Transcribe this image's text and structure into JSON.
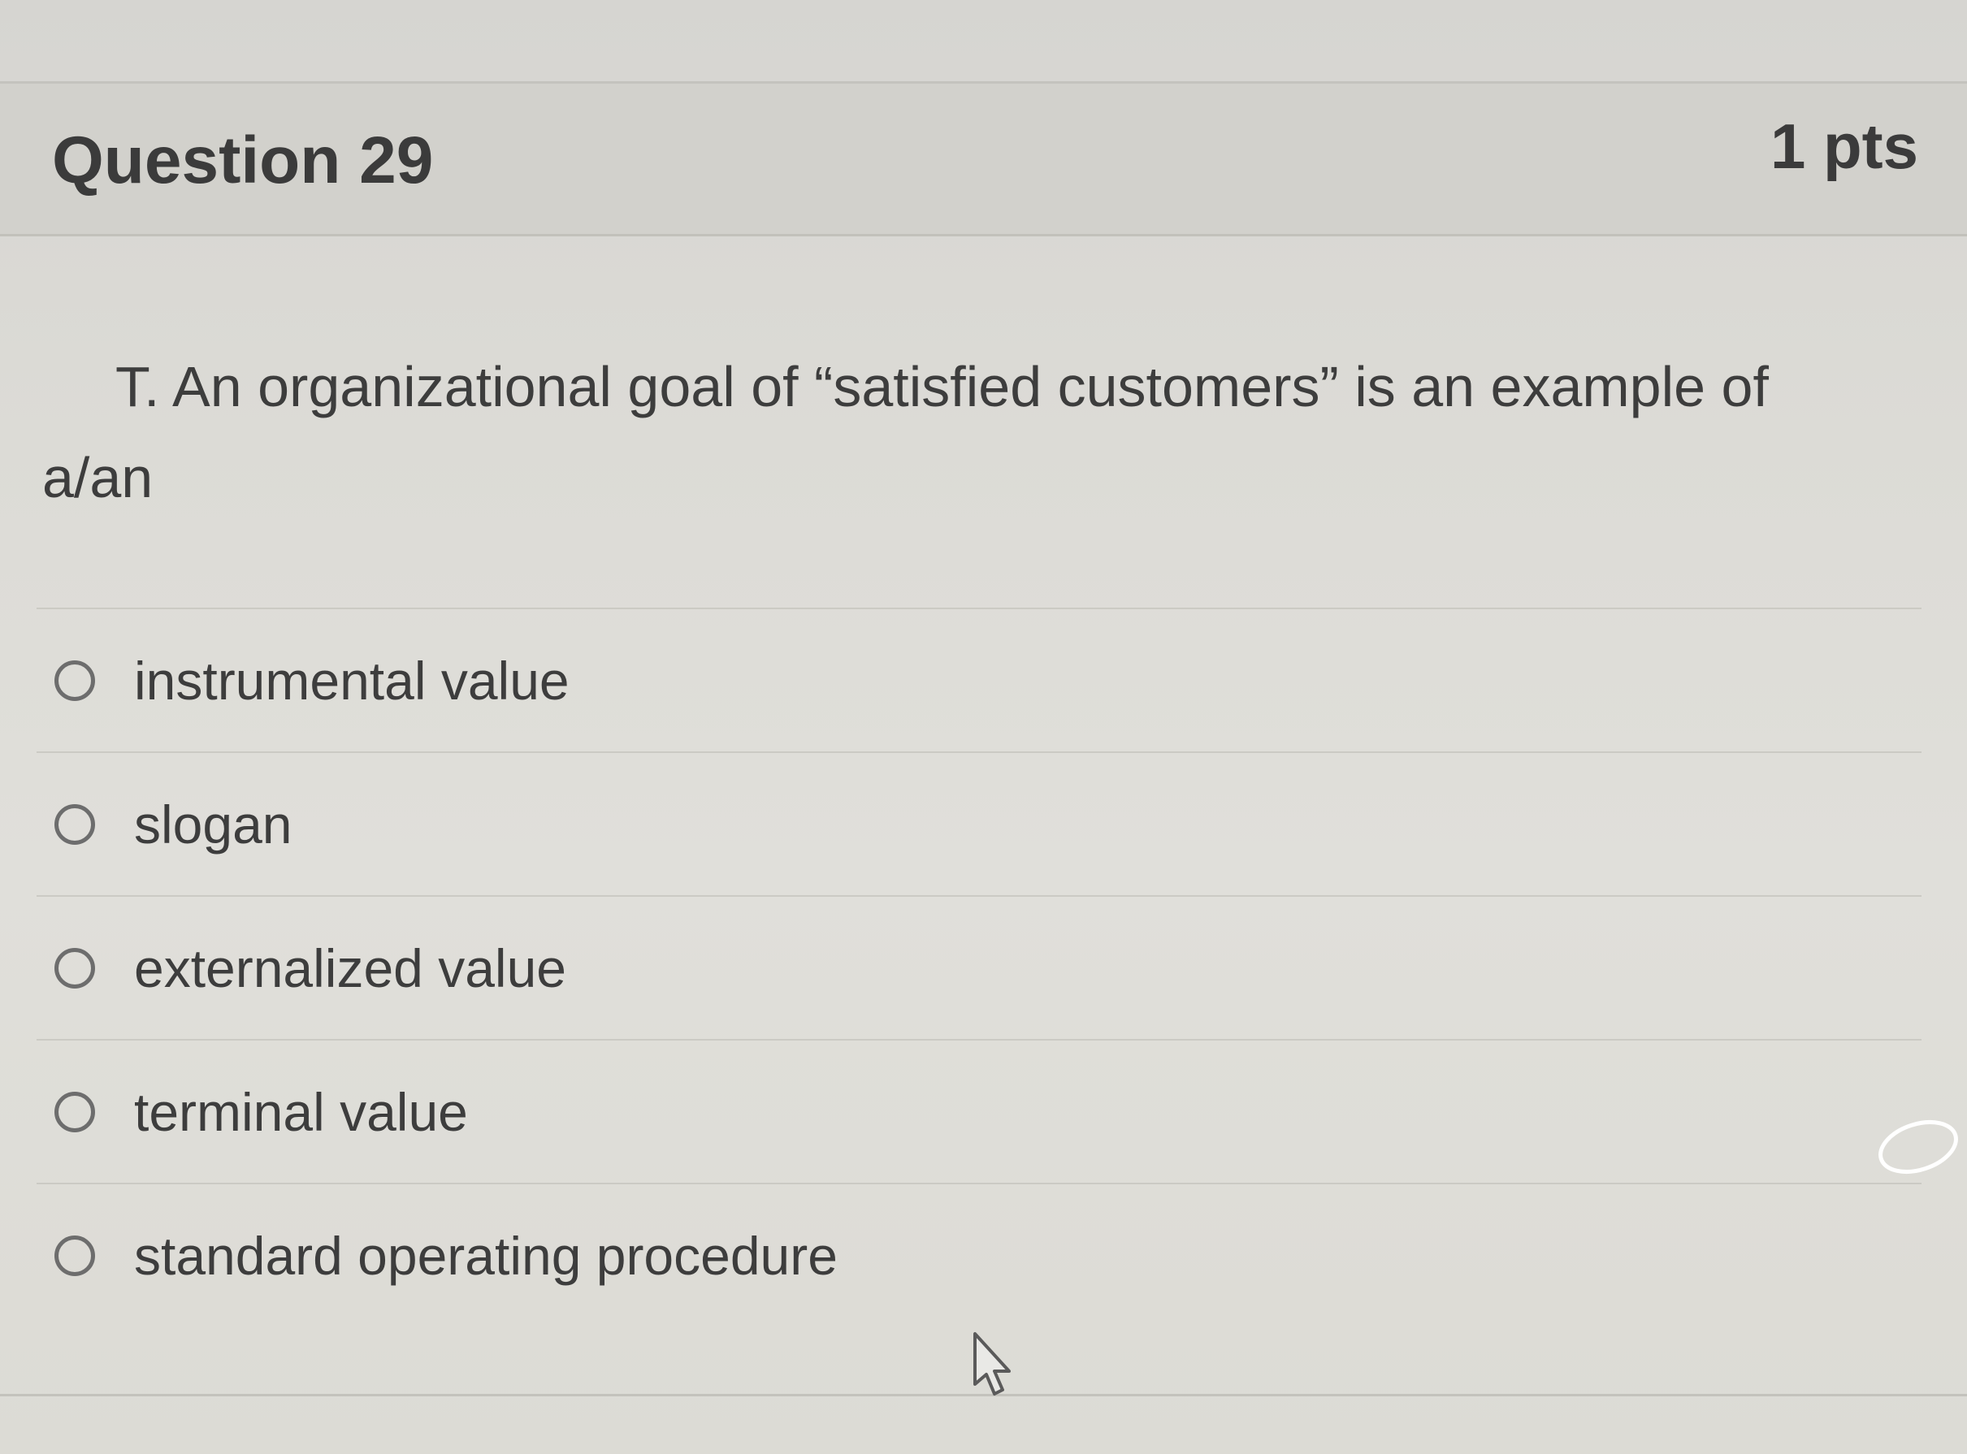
{
  "question": {
    "title": "Question 29",
    "points": "1 pts",
    "text": "T. An organizational goal of “satisfied customers” is an example of a/an"
  },
  "answers": [
    {
      "label": "instrumental value",
      "selected": false
    },
    {
      "label": "slogan",
      "selected": false
    },
    {
      "label": "externalized value",
      "selected": false
    },
    {
      "label": "terminal value",
      "selected": false
    },
    {
      "label": "standard operating procedure",
      "selected": false
    }
  ],
  "icons": {
    "cursor": "mouse-pointer-icon"
  }
}
